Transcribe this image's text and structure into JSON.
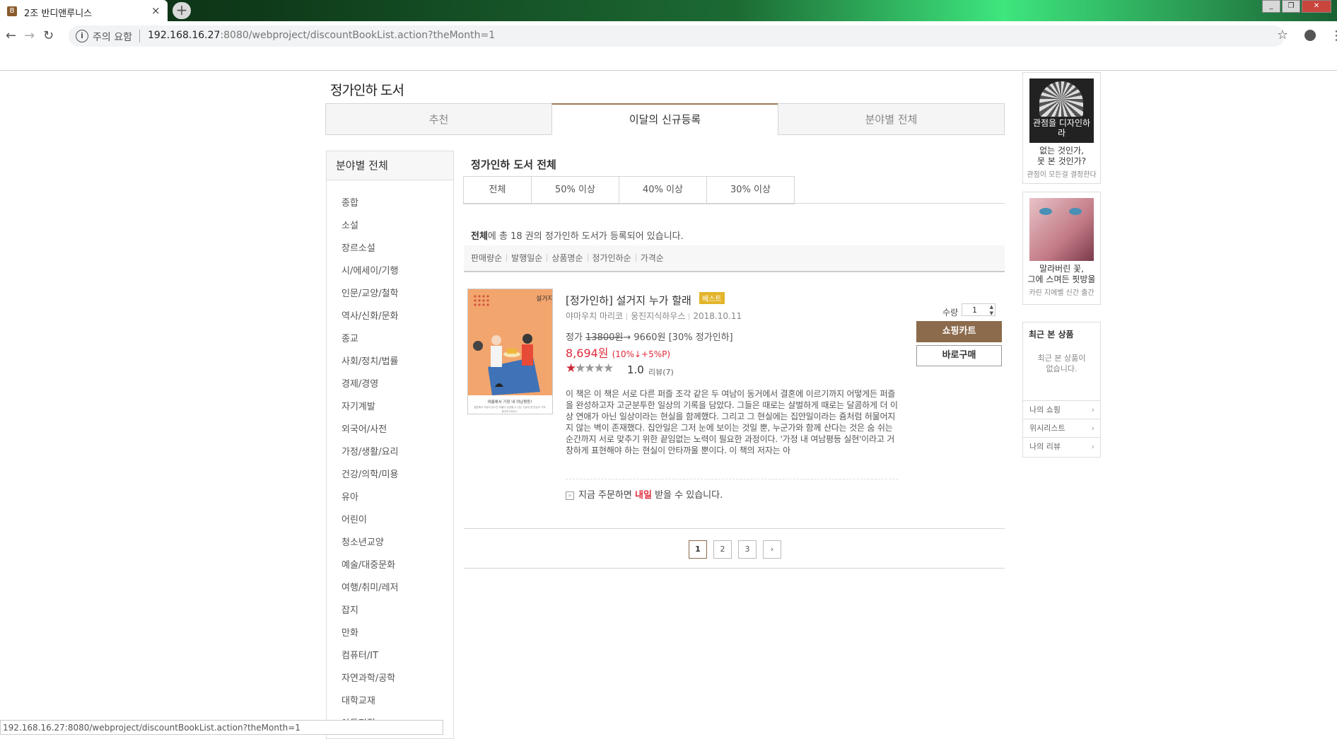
{
  "browser": {
    "tab_title": "2조 반디앤루니스",
    "tab_favicon": "B",
    "security_label": "주의 요함",
    "url_host": "192.168.16.27",
    "url_rest": ":8080/webproject/discountBookList.action?theMonth=1",
    "status_url": "192.168.16.27:8080/webproject/discountBookList.action?theMonth=1"
  },
  "page": {
    "title": "정가인하 도서",
    "tabs": [
      {
        "label": "추천"
      },
      {
        "label": "이달의 신규등록"
      },
      {
        "label": "분야별 전체"
      }
    ],
    "active_tab": 1
  },
  "sidebar": {
    "heading": "분야별 전체",
    "categories": [
      "종합",
      "소설",
      "장르소설",
      "시/에세이/기행",
      "인문/교양/철학",
      "역사/신화/문화",
      "종교",
      "사회/정치/법률",
      "경제/경영",
      "자기계발",
      "외국어/사전",
      "가정/생활/요리",
      "건강/의학/미용",
      "유아",
      "어린이",
      "청소년교양",
      "예술/대중문화",
      "여행/취미/레저",
      "잡지",
      "만화",
      "컴퓨터/IT",
      "자연과학/공학",
      "대학교재",
      "아동전집"
    ]
  },
  "list": {
    "heading": "정가인하 도서 전체",
    "filters": [
      "전체",
      "50% 이상",
      "40% 이상",
      "30% 이상"
    ],
    "count_prefix": "전체",
    "count_text": "에 총 18 권의 정가인하 도서가 등록되어 있습니다.",
    "sort_options": [
      "판매량순",
      "발행일순",
      "상품명순",
      "정가인하순",
      "가격순"
    ]
  },
  "book": {
    "title": "[정가인하] 설거지 누가 할래",
    "badge": "베스트",
    "author": "야마우치 마리코",
    "publisher": "웅진지식하우스",
    "date": "2018.10.11",
    "price_label": "정가",
    "orig_price": "13800원",
    "arrow_price": "→ 9660원",
    "discount_note": "[30% 정가인하]",
    "sale_price": "8,694원",
    "sale_note": "(10%↓+5%P)",
    "stars_filled": 1,
    "stars_total": 5,
    "rating": "1.0",
    "review_label": "리뷰(7)",
    "description": "이 책은 이 책은 서로 다른 퍼즐 조각 같은 두 여남이 동거에서 결혼에 이르기까지 어떻게든 퍼즐을 완성하고자 고군분투한 일상의 기록을 담았다. 그들은 때로는 살벌하게 때로는 달콤하게 더 이상 연애가 아닌 일상이라는 현실을 함께했다. 그리고 그 현실에는 집안일이라는 쥼처럼 허물어지지 않는 벽이 존재했다. 집안일은 그저 눈에 보이는 것일 뿐, 누군가와 함께 산다는 것은 숨 쉬는 순간까지 서로 맞추기 위한 끝임없는 노력이 필요한 과정이다. '가정 내 여남평등 실현'이라고 거창하게 표현해야 하는 현실이 안타까울 뿐이다. 이 책의 저자는 아",
    "delivery_pre": "지금 주문하면 ",
    "delivery_day": "내일",
    "delivery_post": " 받을 수 있습니다.",
    "cover_title": "설거지 누가 할래",
    "cover_tagline": "여름에서 가장 내 여남평등!",
    "cover_subtitle": "결혼해서 사랑이 장시간 허물이 성공할 수 있는 기술의 참 만남고 기하",
    "cover_publisher": "웅진지식하우스"
  },
  "order": {
    "qty_label": "수량",
    "qty_value": "1",
    "cart_label": "쇼핑카트",
    "buy_label": "바로구매"
  },
  "pagination": {
    "pages": [
      "1",
      "2",
      "3"
    ],
    "current": "1",
    "next_icon": "›"
  },
  "right_ads": [
    {
      "img_text": "관점을 디자인하라",
      "caption_1": "없는 것인가,",
      "caption_2": "못 본 것인가?",
      "sub": "관점이 모든걸 결정한다"
    },
    {
      "img_text": "",
      "caption_1": "말라버린 꽃,",
      "caption_2": "그에 스며든 핏방울",
      "sub": "카린 지에벨 신간 출간"
    }
  ],
  "recent": {
    "heading": "최근 본 상품",
    "empty_1": "최근 본 상품이",
    "empty_2": "없습니다.",
    "links": [
      "나의 쇼핑",
      "위시리스트",
      "나의 리뷰"
    ]
  },
  "colors": {
    "accent": "#8b6b4c",
    "sale": "#e02a3b",
    "badge": "#e3b42a"
  }
}
